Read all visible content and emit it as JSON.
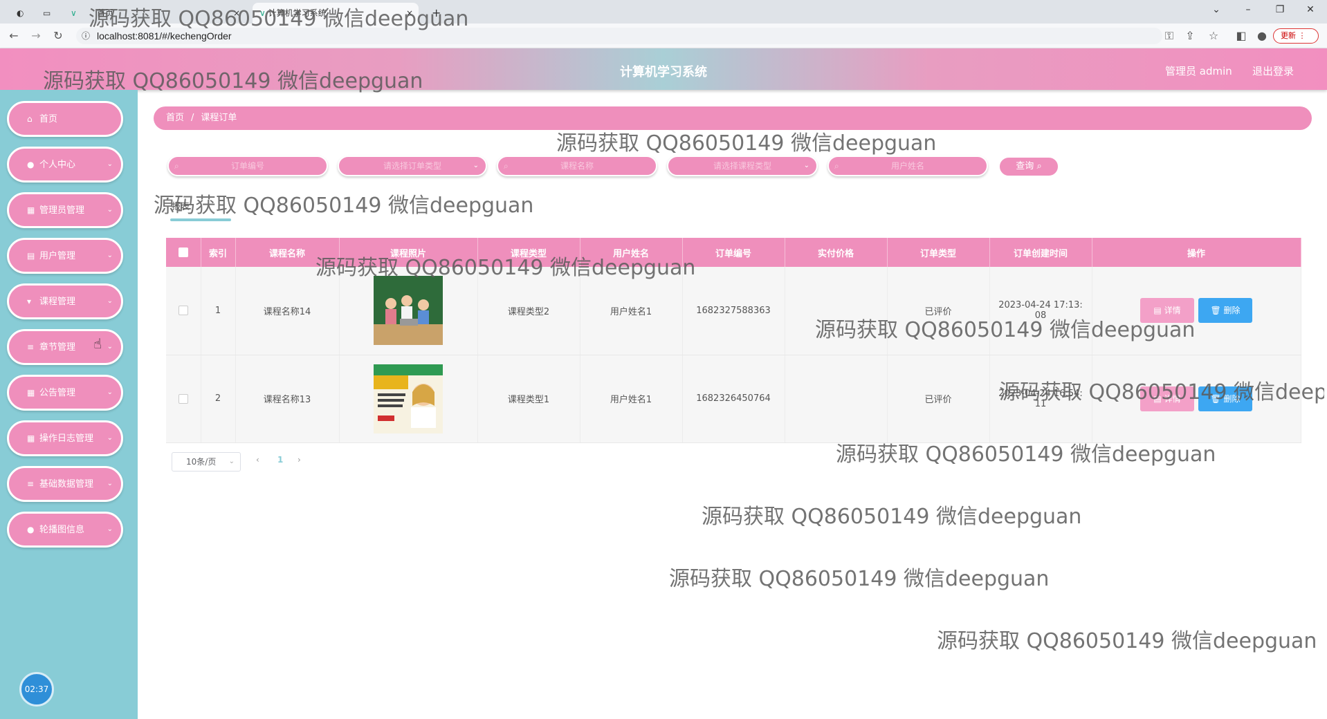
{
  "browser": {
    "tabs": [
      {
        "label": "首页"
      },
      {
        "label": "计算机学习系统"
      }
    ],
    "new_tab": "+",
    "url": "localhost:8081/#/kechengOrder",
    "update_label": "更新"
  },
  "header": {
    "title": "计算机学习系统",
    "user": "管理员 admin",
    "logout": "退出登录"
  },
  "sidebar": {
    "items": [
      {
        "label": "首页",
        "icon": "home-icon",
        "has_arrow": false
      },
      {
        "label": "个人中心",
        "icon": "user-icon",
        "has_arrow": true
      },
      {
        "label": "管理员管理",
        "icon": "grid-icon",
        "has_arrow": true
      },
      {
        "label": "用户管理",
        "icon": "clipboard-icon",
        "has_arrow": true
      },
      {
        "label": "课程管理",
        "icon": "trophy-icon",
        "has_arrow": true
      },
      {
        "label": "章节管理",
        "icon": "list-icon",
        "has_arrow": true
      },
      {
        "label": "公告管理",
        "icon": "grid-icon",
        "has_arrow": true
      },
      {
        "label": "操作日志管理",
        "icon": "grid-icon",
        "has_arrow": true
      },
      {
        "label": "基础数据管理",
        "icon": "list-icon",
        "has_arrow": true
      },
      {
        "label": "轮播图信息",
        "icon": "location-icon",
        "has_arrow": true
      }
    ],
    "clock": "02:37"
  },
  "breadcrumb": {
    "home": "首页",
    "separator": "/",
    "current": "课程订单"
  },
  "search": {
    "order_no_placeholder": "订单编号",
    "order_type_placeholder": "请选择订单类型",
    "course_name_placeholder": "课程名称",
    "course_type_placeholder": "请选择课程类型",
    "user_name_placeholder": "用户姓名",
    "query_button": "查询"
  },
  "actions": {
    "tab_label": "报表"
  },
  "table": {
    "columns": [
      "索引",
      "课程名称",
      "课程照片",
      "课程类型",
      "用户姓名",
      "订单编号",
      "实付价格",
      "订单类型",
      "订单创建时间",
      "操作"
    ],
    "rows": [
      {
        "index": "1",
        "course_name": "课程名称14",
        "course_type": "课程类型2",
        "user_name": "用户姓名1",
        "order_no": "1682327588363",
        "price": "",
        "order_type": "已评价",
        "created_line1": "2023-04-24 17:13:",
        "created_line2": "08"
      },
      {
        "index": "2",
        "course_name": "课程名称13",
        "course_type": "课程类型1",
        "user_name": "用户姓名1",
        "order_no": "1682326450764",
        "price": "",
        "order_type": "已评价",
        "created_line1": "2023-04-24 16:54:",
        "created_line2": "11"
      }
    ],
    "detail_label": "详情",
    "delete_label": "删除"
  },
  "pagination": {
    "page_size": "10条/页",
    "prev": "‹",
    "current": "1",
    "next": "›"
  },
  "watermark": "源码获取 QQ86050149 微信deepguan"
}
